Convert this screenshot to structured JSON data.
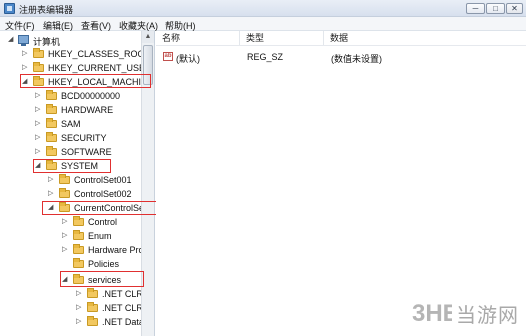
{
  "window": {
    "title": "注册表编辑器",
    "minimize_glyph": "─",
    "maximize_glyph": "□",
    "close_glyph": "✕"
  },
  "menu": [
    "文件(F)",
    "编辑(E)",
    "查看(V)",
    "收藏夹(A)",
    "帮助(H)"
  ],
  "tree": {
    "root": "计算机",
    "items": [
      {
        "label": "HKEY_CLASSES_ROOT",
        "toggle": "▷"
      },
      {
        "label": "HKEY_CURRENT_USER",
        "toggle": "▷"
      },
      {
        "label": "HKEY_LOCAL_MACHINE",
        "toggle": "◢"
      },
      {
        "label": "BCD00000000",
        "toggle": "▷"
      },
      {
        "label": "HARDWARE",
        "toggle": "▷"
      },
      {
        "label": "SAM",
        "toggle": "▷"
      },
      {
        "label": "SECURITY",
        "toggle": "▷"
      },
      {
        "label": "SOFTWARE",
        "toggle": "▷"
      },
      {
        "label": "SYSTEM",
        "toggle": "◢"
      },
      {
        "label": "ControlSet001",
        "toggle": "▷"
      },
      {
        "label": "ControlSet002",
        "toggle": "▷"
      },
      {
        "label": "CurrentControlSet",
        "toggle": "◢"
      },
      {
        "label": "Control",
        "toggle": "▷"
      },
      {
        "label": "Enum",
        "toggle": "▷"
      },
      {
        "label": "Hardware Profiles",
        "toggle": "▷"
      },
      {
        "label": "Policies",
        "toggle": ""
      },
      {
        "label": "services",
        "toggle": "◢"
      },
      {
        "label": ".NET CLR",
        "toggle": "▷"
      },
      {
        "label": ".NET CLR",
        "toggle": "▷"
      },
      {
        "label": ".NET Data",
        "toggle": "▷"
      }
    ]
  },
  "list": {
    "columns": [
      "名称",
      "类型",
      "数据"
    ],
    "rows": [
      {
        "name": "(默认)",
        "type": "REG_SZ",
        "data": "(数值未设置)"
      }
    ]
  },
  "watermark": {
    "text": "当游网"
  },
  "colors": {
    "highlight": "#e03030",
    "folder": "#f2c860"
  }
}
